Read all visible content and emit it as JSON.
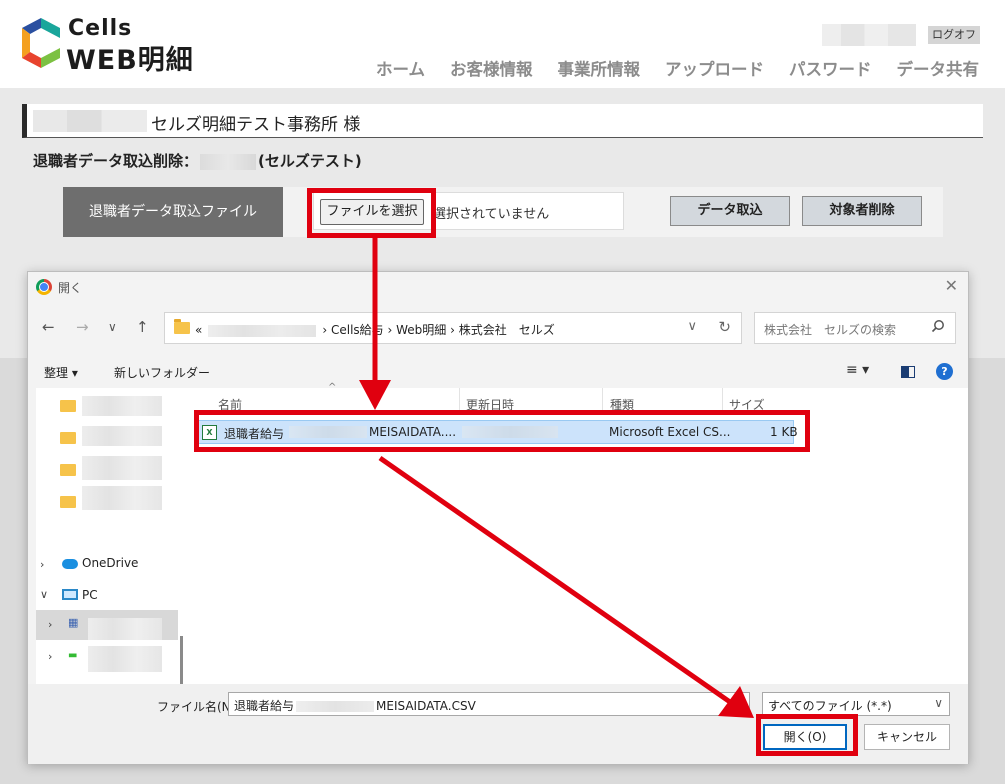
{
  "header": {
    "logo_top": "Cells",
    "logo_bottom": "WEB明細",
    "logout": "ログオフ",
    "nav": [
      "ホーム",
      "お客様情報",
      "事業所情報",
      "アップロード",
      "パスワード",
      "データ共有"
    ]
  },
  "office": {
    "name": "セルズ明細テスト事務所 様"
  },
  "page": {
    "title_prefix": "退職者データ取込削除：",
    "title_suffix": "(セルズテスト)"
  },
  "file_row": {
    "label": "退職者データ取込ファイル",
    "choose_button": "ファイルを選択",
    "no_file": "選択されていません",
    "import_button": "データ取込",
    "delete_button": "対象者削除"
  },
  "dialog": {
    "title": "開く",
    "address_prefix": "«",
    "breadcrumbs": [
      "Cells給与",
      "Web明細",
      "株式会社　セルズ"
    ],
    "search_placeholder": "株式会社　セルズの検索",
    "toolbar": {
      "organize": "整理 ▾",
      "new_folder": "新しいフォルダー",
      "view": "≡ ▾",
      "help": "?"
    },
    "sidebar": {
      "onedrive": "OneDrive",
      "pc": "PC"
    },
    "columns": [
      "名前",
      "更新日時",
      "種類",
      "サイズ"
    ],
    "file": {
      "name_prefix": "退職者給与",
      "name_suffix": "MEISAIDATA....",
      "type": "Microsoft Excel CS...",
      "size": "1 KB"
    },
    "filename_label": "ファイル名(N):",
    "filename_prefix": "退職者給与",
    "filename_suffix": "MEISAIDATA.CSV",
    "filetype": "すべてのファイル (*.*)",
    "open_button": "開く(O)",
    "cancel_button": "キャンセル"
  },
  "colors": {
    "annotation": "#e0000f",
    "accent": "#0067c0",
    "dark_panel": "#6e6e6e"
  }
}
